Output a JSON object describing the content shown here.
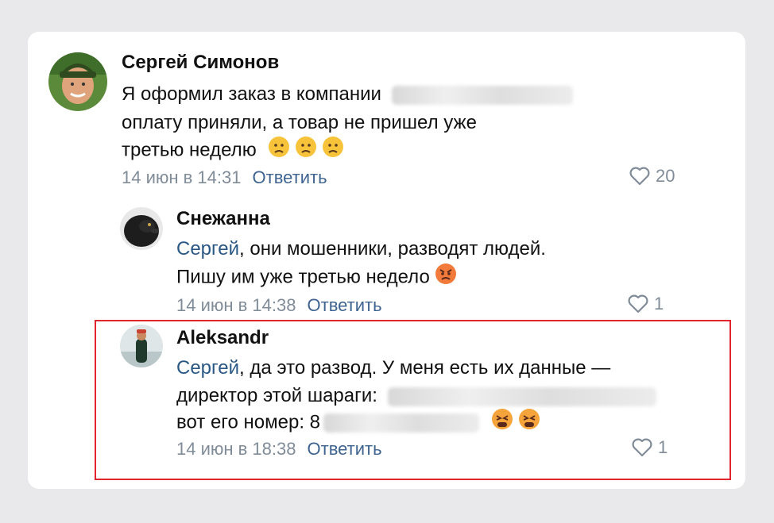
{
  "comments": [
    {
      "author": "Сергей Симонов",
      "text_line1": "Я оформил заказ в компании",
      "text_line2": "оплату приняли, а товар не пришел уже",
      "text_line3": "третью неделю",
      "date": "14 июн в 14:31",
      "reply_label": "Ответить",
      "likes": "20"
    },
    {
      "author": "Снежанна",
      "mention": "Сергей",
      "text_line1_rest": ", они мошенники, разводят людей.",
      "text_line2": "Пишу им уже третью недело",
      "date": "14 июн в 14:38",
      "reply_label": "Ответить",
      "likes": "1"
    },
    {
      "author": "Aleksandr",
      "mention": "Сергей",
      "text_line1_rest": ", да это развод. У меня есть их данные —",
      "text_line2": "директор этой шараги:",
      "text_line3": "вот его номер: 8",
      "date": "14 июн в 18:38",
      "reply_label": "Ответить",
      "likes": "1"
    }
  ],
  "icons": {
    "like": "heart-outline-icon",
    "sad": "worried-face-emoji",
    "angry": "angry-face-emoji",
    "tired": "tired-face-emoji"
  },
  "colors": {
    "mention": "#2a5885",
    "meta": "#818c99",
    "highlight_border": "#e1262d"
  }
}
